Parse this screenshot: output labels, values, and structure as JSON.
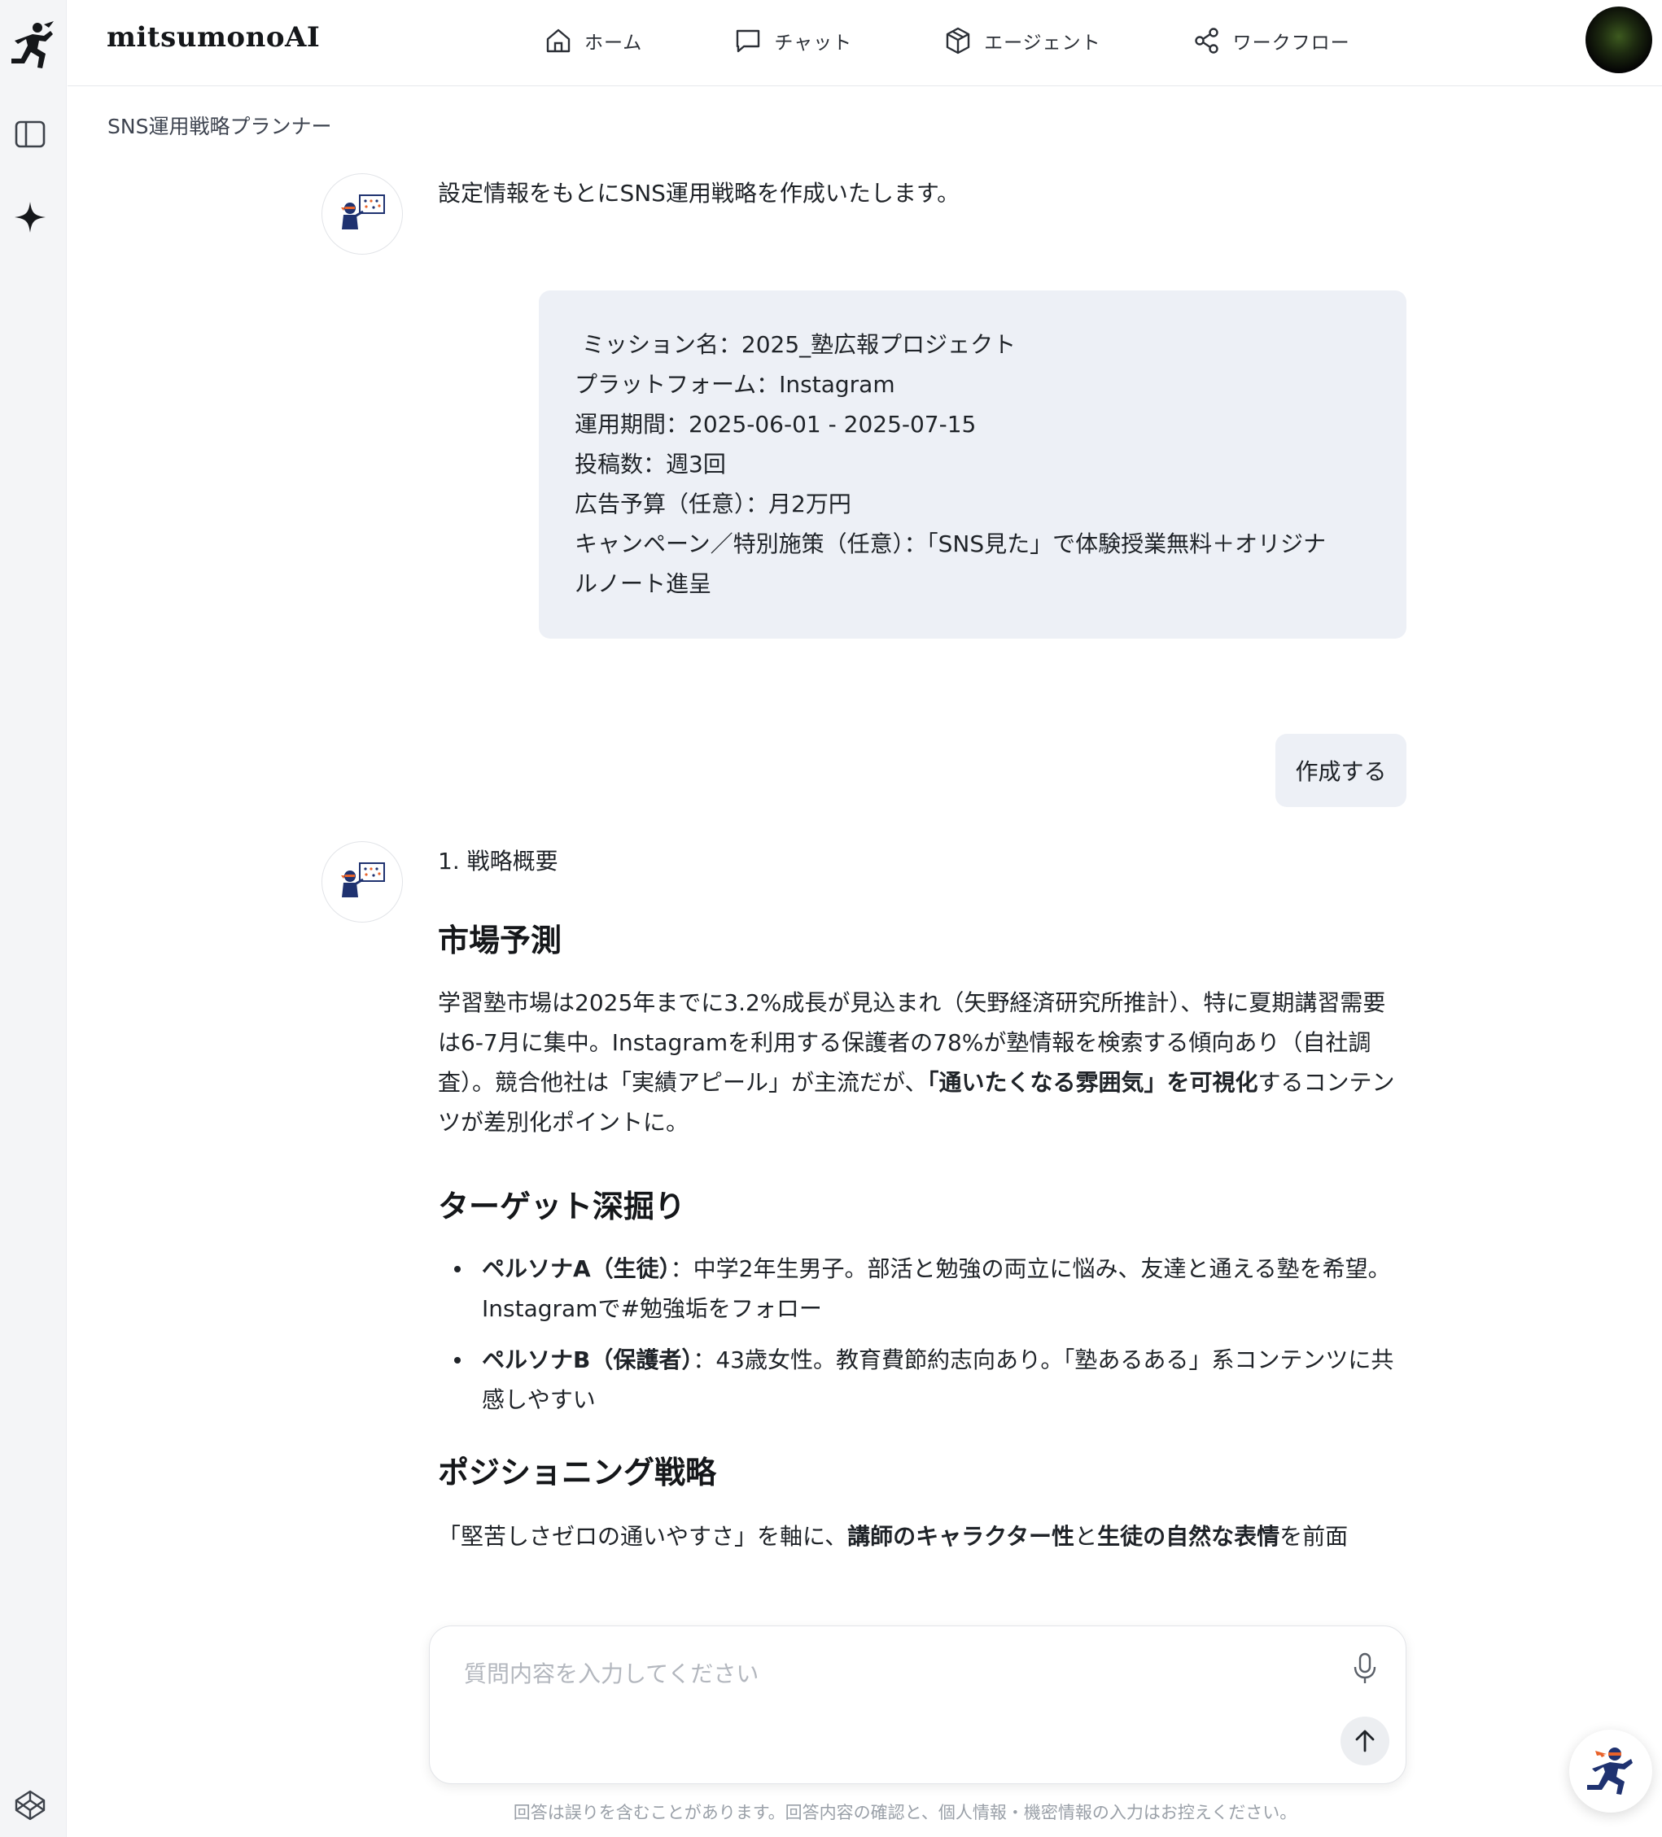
{
  "app": {
    "brand": "mitsumonoAI",
    "breadcrumb": "SNS運用戦略プランナー"
  },
  "nav": {
    "items": [
      {
        "label": "ホーム",
        "icon": "home-icon"
      },
      {
        "label": "チャット",
        "icon": "chat-icon"
      },
      {
        "label": "エージェント",
        "icon": "cube-icon"
      },
      {
        "label": "ワークフロー",
        "icon": "share-icon"
      }
    ]
  },
  "sidebar": {
    "icons": [
      "runner-logo-icon",
      "sidebar-toggle-icon",
      "sparkle-icon",
      "codepen-icon"
    ]
  },
  "chat": {
    "intro": "設定情報をもとにSNS運用戦略を作成いたします。",
    "settings": {
      "mission": " ミッション名：2025_塾広報プロジェクト",
      "platform": "プラットフォーム：Instagram",
      "period": "運用期間：2025-06-01 - 2025-07-15",
      "posts": "投稿数：週3回",
      "budget": "広告予算（任意）：月2万円",
      "campaign_line1": "キャンペーン／特別施策（任意）：「SNS見た」で体験授業無料＋オリジナ",
      "campaign_line2": "ルノート進呈"
    },
    "user_message": "作成する",
    "response": {
      "section_number": "1. 戦略概要",
      "market_heading": "市場予測",
      "market_text_1": "学習塾市場は2025年までに3.2%成長が見込まれ（矢野経済研究所推計）、特に夏期講習需要は6-7月に集中。Instagramを利用する保護者の78%が塾情報を検索する傾向あり（自社調査）。競合他社は「実績アピール」が主流だが、",
      "market_text_bold": "「通いたくなる雰囲気」を可視化",
      "market_text_2": "するコンテンツが差別化ポイントに。",
      "target_heading": "ターゲット深掘り",
      "persona_a_label": "ペルソナA（生徒）",
      "persona_a_text": "：中学2年生男子。部活と勉強の両立に悩み、友達と通える塾を希望。Instagramで#勉強垢をフォロー",
      "persona_b_label": "ペルソナB（保護者）",
      "persona_b_text": "：43歳女性。教育費節約志向あり。「塾あるある」系コンテンツに共感しやすい",
      "positioning_heading": "ポジショニング戦略",
      "positioning_text_1": "「堅苦しさゼロの通いやすさ」を軸に、",
      "positioning_bold_1": "講師のキャラクター性",
      "positioning_text_2": "と",
      "positioning_bold_2": "生徒の自然な表情",
      "positioning_text_3": "を前面"
    }
  },
  "composer": {
    "placeholder": "質問内容を入力してください"
  },
  "disclaimer": "回答は誤りを含むことがあります。回答内容の確認と、個人情報・機密情報の入力はお控えください。",
  "colors": {
    "card_bg": "#edf0f6",
    "sidebar_bg": "#f4f5f7",
    "ninja_navy": "#1f3270",
    "ninja_orange": "#e8622a"
  }
}
